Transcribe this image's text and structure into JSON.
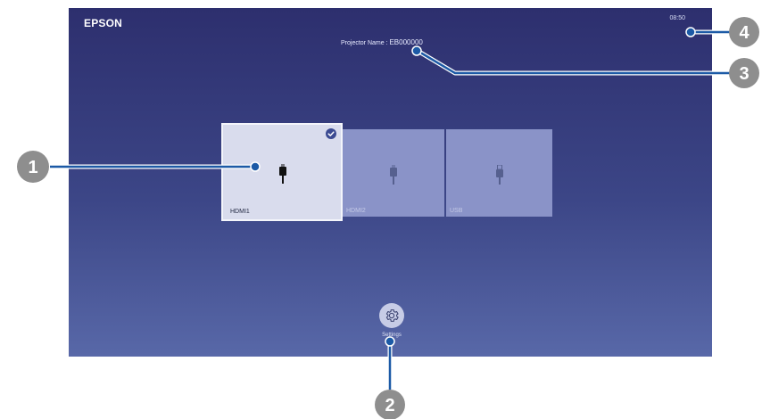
{
  "brand": "EPSON",
  "clock": "08:50",
  "projector": {
    "label": "Projector Name : ",
    "value": "EB000000"
  },
  "sources": [
    {
      "label": "HDMI1",
      "selected": true
    },
    {
      "label": "HDMI2",
      "selected": false
    },
    {
      "label": "USB",
      "selected": false
    }
  ],
  "settings_label": "Settings",
  "callouts": [
    "1",
    "2",
    "3",
    "4"
  ],
  "colors": {
    "callout_gray": "#8e8e8e",
    "callout_blue": "#1c5aa6",
    "screen_top": "#2d2f6e",
    "screen_bottom": "#5868a8"
  }
}
